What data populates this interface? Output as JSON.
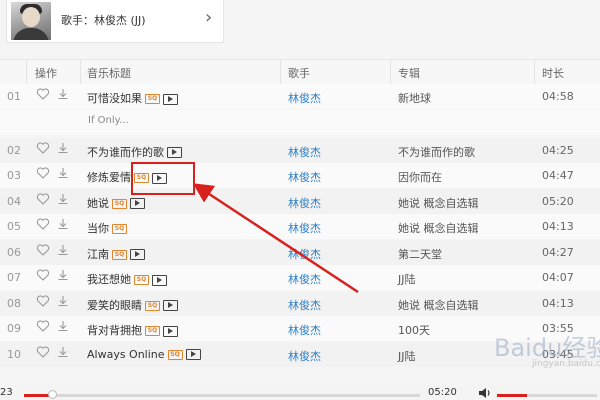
{
  "artist_card": {
    "label": "歌手：林俊杰 (JJ)"
  },
  "table": {
    "headers": {
      "action": "操作",
      "title": "音乐标题",
      "singer": "歌手",
      "album": "专辑",
      "duration": "时长"
    },
    "rows": [
      {
        "index": "01",
        "title": "可惜没如果",
        "sq": true,
        "mv": true,
        "singer": "林俊杰",
        "album": "新地球",
        "duration": "04:58",
        "subtitle": "If Only..."
      },
      {
        "index": "02",
        "title": "不为谁而作的歌",
        "sq": false,
        "mv": true,
        "singer": "林俊杰",
        "album": "不为谁而作的歌",
        "duration": "04:25"
      },
      {
        "index": "03",
        "title": "修炼爱情",
        "sq": true,
        "mv": true,
        "singer": "林俊杰",
        "album": "因你而在",
        "duration": "04:47"
      },
      {
        "index": "04",
        "title": "她说",
        "sq": true,
        "mv": true,
        "singer": "林俊杰",
        "album": "她说 概念自选辑",
        "duration": "05:20"
      },
      {
        "index": "05",
        "title": "当你",
        "sq": true,
        "mv": false,
        "singer": "林俊杰",
        "album": "她说 概念自选辑",
        "duration": "04:13"
      },
      {
        "index": "06",
        "title": "江南",
        "sq": true,
        "mv": true,
        "singer": "林俊杰",
        "album": "第二天堂",
        "duration": "04:27"
      },
      {
        "index": "07",
        "title": "我还想她",
        "sq": true,
        "mv": true,
        "singer": "林俊杰",
        "album": "JJ陆",
        "duration": "04:07"
      },
      {
        "index": "08",
        "title": "爱笑的眼睛",
        "sq": true,
        "mv": true,
        "singer": "林俊杰",
        "album": "她说 概念自选辑",
        "duration": "04:13"
      },
      {
        "index": "09",
        "title": "背对背拥抱",
        "sq": true,
        "mv": true,
        "singer": "林俊杰",
        "album": "100天",
        "duration": "03:55"
      },
      {
        "index": "10",
        "title": "Always Online",
        "sq": true,
        "mv": true,
        "singer": "林俊杰",
        "album": "JJ陆",
        "duration": "03:45"
      }
    ]
  },
  "player": {
    "elapsed": "23",
    "total": "05:20",
    "progress_fraction": 0.07,
    "volume_fraction": 0.3
  },
  "badges": {
    "sq_text": "SQ"
  },
  "watermark": {
    "main": "Baidu经验",
    "sub": "jingyan.baidu.com"
  },
  "colors": {
    "accent": "#d8201d",
    "link": "#2b7ec4",
    "sq": "#e0872d"
  }
}
